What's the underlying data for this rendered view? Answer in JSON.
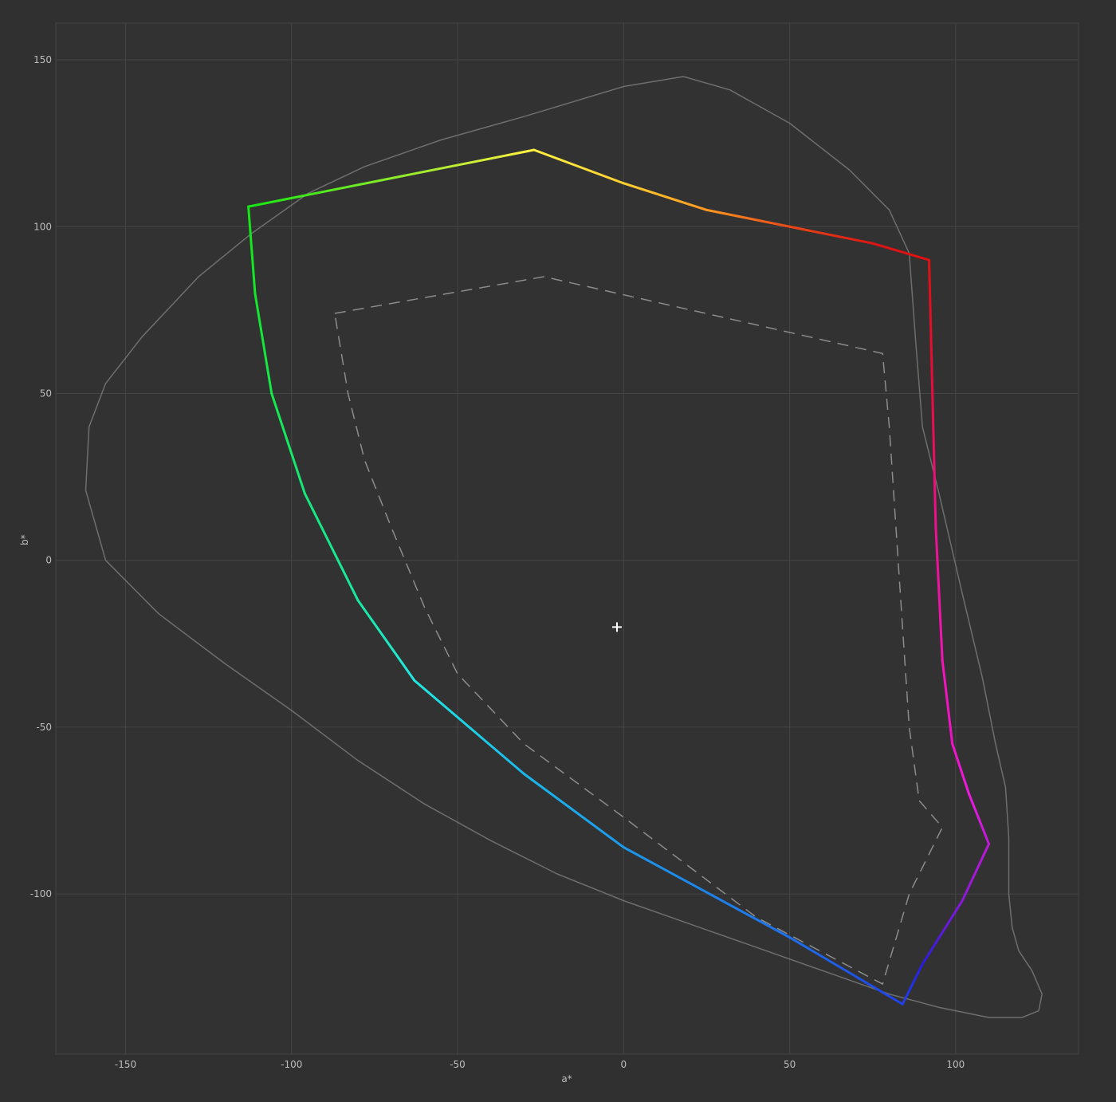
{
  "chart_data": {
    "type": "line",
    "title": "",
    "xlabel": "a*",
    "ylabel": "b*",
    "xlim": [
      -171,
      137
    ],
    "ylim": [
      -148,
      161
    ],
    "x_ticks": [
      -150,
      -100,
      -50,
      0,
      50,
      100
    ],
    "y_ticks": [
      150,
      100,
      50,
      0,
      -50,
      -100
    ],
    "x_tick_labels": [
      "-150",
      "-100",
      "-50",
      "0",
      "50",
      "100"
    ],
    "y_tick_labels": [
      "150",
      "100",
      "50",
      "0",
      "-50",
      "-100"
    ],
    "grid": true,
    "colors": {
      "background": "#303030",
      "plot_background": "#323232",
      "grid": "#454545",
      "text": "#bdbdbd",
      "outline": "#6e6e6e",
      "reference": "#8c8c8c",
      "white_point": "#ffffff"
    },
    "series": [
      {
        "role": "spectral-locus-outline",
        "style": "solid-grey",
        "points": [
          [
            -156,
            0
          ],
          [
            -162,
            21
          ],
          [
            -161,
            40
          ],
          [
            -156,
            53
          ],
          [
            -145,
            67
          ],
          [
            -128,
            85
          ],
          [
            -112,
            98
          ],
          [
            -95,
            110
          ],
          [
            -78,
            118
          ],
          [
            -55,
            126
          ],
          [
            -30,
            133
          ],
          [
            0,
            142
          ],
          [
            18,
            145
          ],
          [
            32,
            141
          ],
          [
            50,
            131
          ],
          [
            68,
            117
          ],
          [
            80,
            105
          ],
          [
            86,
            92
          ],
          [
            88,
            65
          ],
          [
            90,
            40
          ],
          [
            95,
            20
          ],
          [
            102,
            -10
          ],
          [
            108,
            -35
          ],
          [
            112,
            -55
          ],
          [
            115,
            -68
          ],
          [
            116,
            -83
          ],
          [
            116,
            -100
          ],
          [
            117,
            -110
          ],
          [
            119,
            -117
          ],
          [
            123,
            -123
          ],
          [
            126,
            -130
          ],
          [
            125,
            -135
          ],
          [
            120,
            -137
          ],
          [
            110,
            -137
          ],
          [
            95,
            -134
          ],
          [
            80,
            -130
          ],
          [
            60,
            -123
          ],
          [
            40,
            -116
          ],
          [
            20,
            -109
          ],
          [
            0,
            -102
          ],
          [
            -20,
            -94
          ],
          [
            -40,
            -84
          ],
          [
            -60,
            -73
          ],
          [
            -80,
            -60
          ],
          [
            -100,
            -45
          ],
          [
            -120,
            -31
          ],
          [
            -140,
            -16
          ],
          [
            -156,
            0
          ]
        ]
      },
      {
        "role": "reference-gamut-dashed",
        "style": "dashed-grey",
        "points": [
          [
            -87,
            74
          ],
          [
            -24,
            85
          ],
          [
            78,
            62
          ],
          [
            80,
            40
          ],
          [
            82,
            10
          ],
          [
            84,
            -20
          ],
          [
            86,
            -50
          ],
          [
            89,
            -72
          ],
          [
            96,
            -80
          ],
          [
            86,
            -100
          ],
          [
            78,
            -127
          ],
          [
            40,
            -107
          ],
          [
            0,
            -77
          ],
          [
            -30,
            -55
          ],
          [
            -50,
            -34
          ],
          [
            -60,
            -14
          ],
          [
            -70,
            10
          ],
          [
            -78,
            30
          ],
          [
            -83,
            50
          ],
          [
            -87,
            74
          ]
        ]
      },
      {
        "role": "gamut-colored",
        "style": "solid-gradient",
        "points": [
          [
            -113,
            106
          ],
          [
            -27,
            123
          ],
          [
            0,
            113
          ],
          [
            25,
            105
          ],
          [
            50,
            100
          ],
          [
            75,
            95
          ],
          [
            92,
            90
          ],
          [
            93,
            50
          ],
          [
            94,
            10
          ],
          [
            96,
            -30
          ],
          [
            99,
            -55
          ],
          [
            104,
            -70
          ],
          [
            110,
            -85
          ],
          [
            102,
            -102
          ],
          [
            90,
            -121
          ],
          [
            84,
            -133
          ],
          [
            50,
            -113
          ],
          [
            0,
            -86
          ],
          [
            -30,
            -64
          ],
          [
            -63,
            -36
          ],
          [
            -80,
            -12
          ],
          [
            -96,
            20
          ],
          [
            -106,
            50
          ],
          [
            -111,
            80
          ],
          [
            -113,
            106
          ]
        ],
        "vertex_colors": [
          "#14e614",
          "#fff040",
          "#ffd030",
          "#ff9820",
          "#e84818",
          "#dd1515",
          "#e01010",
          "#ea0c40",
          "#ee1090",
          "#f215b8",
          "#f012c8",
          "#ee1ae0",
          "#c018d8",
          "#8a18d8",
          "#2a1cde",
          "#2040ea",
          "#1e70ea",
          "#1c98ea",
          "#1ab8ea",
          "#22e8e0",
          "#1ae8a0",
          "#16e87a",
          "#16e84a",
          "#14e62a",
          "#14e614"
        ]
      }
    ],
    "white_point": {
      "a": -2,
      "b": -20
    }
  }
}
